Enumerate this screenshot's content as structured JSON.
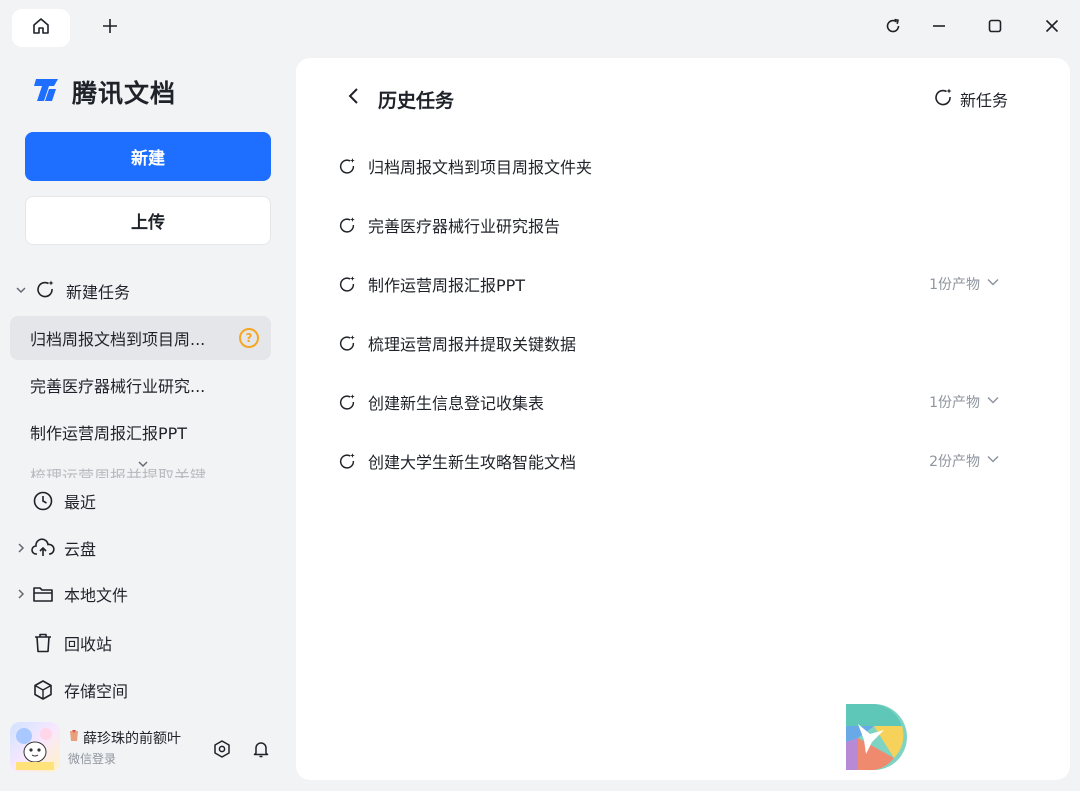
{
  "titlebar": {
    "home_icon": "home-icon",
    "add_tab_icon": "plus-icon",
    "window_controls": [
      "refresh-icon",
      "minimize-icon",
      "maximize-icon",
      "close-icon"
    ]
  },
  "sidebar": {
    "app_name": "腾讯文档",
    "new_label": "新建",
    "upload_label": "上传",
    "task_group_label": "新建任务",
    "tasks": [
      {
        "label": "归档周报文档到项目周..."
      },
      {
        "label": "完善医疗器械行业研究..."
      },
      {
        "label": "制作运营周报汇报PPT"
      }
    ],
    "faded_task": "梳理运营周报并提取关键",
    "nav": [
      {
        "label": "最近",
        "icon": "clock-icon"
      },
      {
        "label": "云盘",
        "icon": "cloud-upload-icon"
      },
      {
        "label": "本地文件",
        "icon": "folder-icon"
      },
      {
        "label": "回收站",
        "icon": "trash-icon"
      },
      {
        "label": "存储空间",
        "icon": "cube-icon"
      }
    ],
    "user": {
      "name": "薛珍珠的前额叶",
      "sub": "微信登录"
    }
  },
  "main": {
    "title": "历史任务",
    "new_task_label": "新任务",
    "history": [
      {
        "label": "归档周报文档到项目周报文件夹",
        "meta": ""
      },
      {
        "label": "完善医疗器械行业研究报告",
        "meta": ""
      },
      {
        "label": "制作运营周报汇报PPT",
        "meta": "1份产物"
      },
      {
        "label": "梳理运营周报并提取关键数据",
        "meta": ""
      },
      {
        "label": "创建新生信息登记收集表",
        "meta": "1份产物"
      },
      {
        "label": "创建大学生新生攻略智能文档",
        "meta": "2份产物"
      }
    ]
  },
  "colors": {
    "accent": "#1e6fff",
    "warning": "#f5a623",
    "background": "#f2f3f5"
  }
}
